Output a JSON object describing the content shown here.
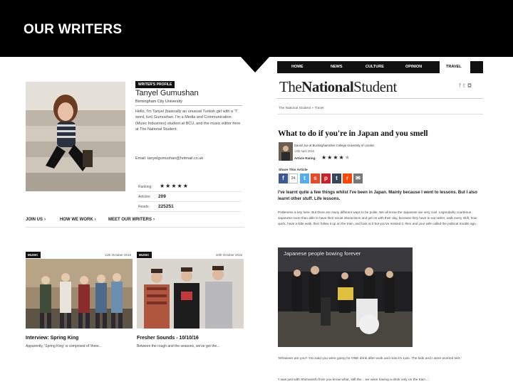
{
  "slide": {
    "title": "OUR WRITERS"
  },
  "profile": {
    "tag": "WRITER'S PROFILE",
    "name": "Tanyel Gumushan",
    "university": "Birmingham City University",
    "bio": "Hello, I'm Tanyel (basically an unusual Turkish girl with a 'T' word, fun) Gumushan. I'm a Media and Communication (Music Industries) student at BCU, and the music editor here at The National Student.",
    "email": "Email: tanyelgumushan@hotmail.co.uk",
    "stats": [
      {
        "label": "Ranking:",
        "value": "★★★★★",
        "kind": "stars",
        "rating": 5
      },
      {
        "label": "Articles:",
        "value": "209",
        "kind": "number"
      },
      {
        "label": "Reads:",
        "value": "225251",
        "kind": "number"
      }
    ],
    "links": [
      "JOIN US",
      "HOW WE WORK",
      "MEET OUR WRITERS"
    ]
  },
  "cards": [
    {
      "tag": "MUSIC",
      "date": "11th October 2016",
      "title": "Interview: Spring King",
      "desc": "Apparently, 'Spring King' is comprised of 'three..."
    },
    {
      "tag": "MUSIC",
      "date": "10th October 2016",
      "title": "Fresher Sounds - 10/10/16",
      "desc": "Between the rough and the seasons, we've got the..."
    }
  ],
  "article": {
    "nav": [
      "HOME",
      "NEWS",
      "CULTURE",
      "OPINION",
      "TRAVEL"
    ],
    "active_nav": "TRAVEL",
    "masthead": {
      "part1": "The",
      "part2": "National",
      "part3": "Student"
    },
    "social_icons": [
      "facebook-icon",
      "twitter-icon",
      "instagram-icon"
    ],
    "breadcrumb": "The National Student » Travel",
    "title": "What to do if you're in Japan and you smell",
    "author_line": "Daniel Joe at Buckinghamshire College University of London",
    "date_line": "14th April 2016",
    "rating_label": "Article Rating:",
    "rating": 4,
    "share_label": "Share This Article",
    "share_count": "24",
    "share_buttons": [
      {
        "icon": "facebook-icon",
        "glyph": "f",
        "color": "#3b5998"
      },
      {
        "icon": "twitter-icon",
        "glyph": "t",
        "color": "#55acee"
      },
      {
        "icon": "stumbleupon-icon",
        "glyph": "s",
        "color": "#eb4924"
      },
      {
        "icon": "pinterest-icon",
        "glyph": "p",
        "color": "#cb2027"
      },
      {
        "icon": "tumblr-icon",
        "glyph": "t",
        "color": "#35465c"
      },
      {
        "icon": "reddit-icon",
        "glyph": "r",
        "color": "#ff4500"
      },
      {
        "icon": "email-icon",
        "glyph": "✉",
        "color": "#777777"
      }
    ],
    "lede": "I've learnt quite a few things whilst I've been in Japan. Mainly because I went to lessons. But I also learnt other stuff. Life lessons.",
    "body": "Politeness is key here. But there are many different ways to be polite. We all know the Japanese are very cool. Legendarily courteous. Japanese more than able to have their social interactions and get on with their day, because they have to eat rather, walk every shift, how quick, have a little walk, then follow it up on the train, and look at it but you've missed it, then and your wife called the political trouble ago.",
    "video_title": "Japanese people bowing forever",
    "quote1": "'Whatever are you? You said you were going for ONE drink after work and now it's 1am. The kids and I were worried sick.'",
    "quote2": "'I was just with Shimanishi from you know what, still the... we were having a drink only on the train...'"
  }
}
